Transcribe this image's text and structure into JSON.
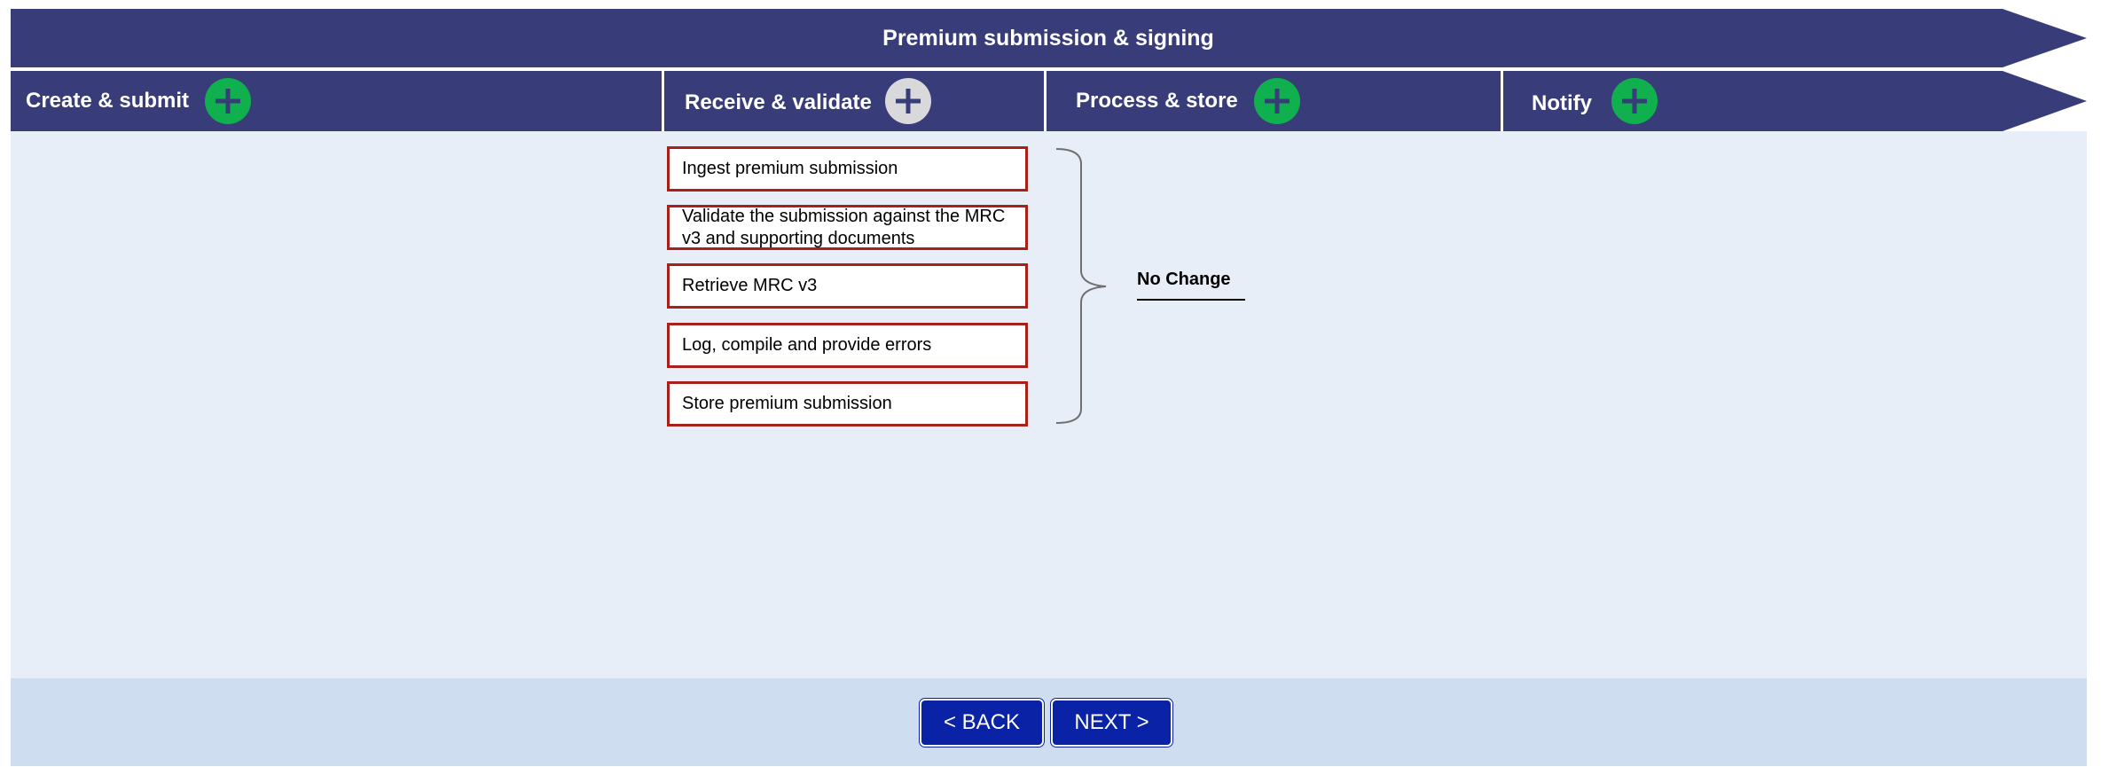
{
  "banner": {
    "title": "Premium submission & signing"
  },
  "stages": [
    {
      "label": "Create & submit",
      "icon": "plus-icon",
      "active": true
    },
    {
      "label": "Receive & validate",
      "icon": "plus-icon",
      "active": false
    },
    {
      "label": "Process & store",
      "icon": "plus-icon",
      "active": true
    },
    {
      "label": "Notify",
      "icon": "plus-icon",
      "active": true
    }
  ],
  "steps": [
    "Ingest premium submission",
    "Validate the submission against the MRC v3 and supporting documents",
    "Retrieve MRC v3",
    "Log, compile and provide errors",
    "Store premium submission"
  ],
  "annotation": {
    "text": "No Change"
  },
  "nav": {
    "back_label": "< BACK",
    "next_label": "NEXT >"
  },
  "colors": {
    "header": "#383d7a",
    "plus_active": "#10b04f",
    "plus_inactive": "#d9d9dc",
    "content_bg": "#e8eef8",
    "footer_bg": "#cfddf0",
    "step_border": "#a8201a",
    "button": "#0a23a6"
  }
}
